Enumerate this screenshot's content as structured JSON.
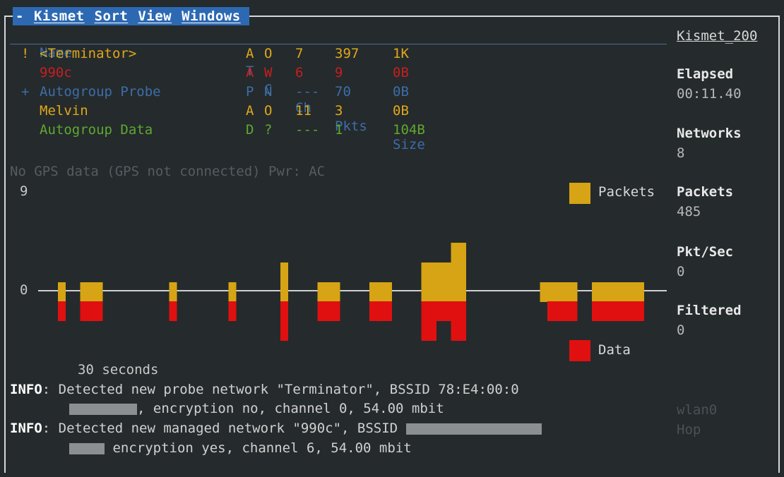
{
  "menubar": {
    "system_icon": "-",
    "items": [
      "Kismet",
      "Sort",
      "View",
      "Windows"
    ]
  },
  "title_right": "Kismet_200",
  "table": {
    "headers": {
      "name": "Name",
      "t": "T",
      "c": "C",
      "ch": "Ch",
      "pkts": "Pkts",
      "size": "Size"
    },
    "rows": [
      {
        "flag": "!",
        "name": "<Terminator>",
        "t": "A",
        "c": "O",
        "ch": "7",
        "pkts": "397",
        "size": "1K",
        "color": "#e0a81a"
      },
      {
        "flag": "",
        "name": "990c",
        "t": "A",
        "c": "W",
        "ch": "6",
        "pkts": "9",
        "size": "0B",
        "color": "#c81e1e"
      },
      {
        "flag": "+",
        "name": "Autogroup Probe",
        "t": "P",
        "c": "N",
        "ch": "---",
        "pkts": "70",
        "size": "0B",
        "color": "#3c6ea8"
      },
      {
        "flag": "",
        "name": "Melvin",
        "t": "A",
        "c": "O",
        "ch": "11",
        "pkts": "3",
        "size": "0B",
        "color": "#e0a81a"
      },
      {
        "flag": "",
        "name": "Autogroup Data",
        "t": "D",
        "c": "?",
        "ch": "---",
        "pkts": "1",
        "size": "104B",
        "color": "#5fa832"
      }
    ]
  },
  "status_msg": "No GPS data (GPS not connected) Pwr: AC",
  "sidebar": {
    "elapsed_label": "Elapsed",
    "elapsed_value": "00:11.40",
    "networks_label": "Networks",
    "networks_value": "8",
    "packets_label": "Packets",
    "packets_value": "485",
    "pktsec_label": "Pkt/Sec",
    "pktsec_value": "0",
    "filtered_label": "Filtered",
    "filtered_value": "0",
    "iface_name": "wlan0",
    "iface_mode": "Hop"
  },
  "chart_data": {
    "type": "bar",
    "y_top_label": "9",
    "y_zero_label": "0",
    "x_label": "30 seconds",
    "legend_packets": "Packets",
    "legend_data": "Data",
    "packets_color": "#d6a414",
    "data_color": "#e01010",
    "packets": [
      1,
      0,
      0,
      1,
      1,
      1,
      0,
      0,
      0,
      0,
      0,
      0,
      0,
      0,
      0,
      1,
      0,
      0,
      0,
      0,
      0,
      0,
      0,
      1,
      0,
      0,
      0,
      0,
      0,
      0,
      2,
      0,
      0,
      0,
      0,
      1,
      1,
      1,
      0,
      0,
      0,
      0,
      1,
      1,
      1,
      0,
      0,
      0,
      0,
      2,
      2,
      2,
      2,
      3,
      3,
      0,
      0,
      0,
      0,
      0,
      0,
      0,
      0,
      0,
      0,
      1,
      1,
      1,
      1,
      1,
      0,
      0,
      1,
      1,
      1,
      1,
      1,
      1,
      1,
      0
    ],
    "data": [
      1,
      0,
      0,
      1,
      1,
      1,
      0,
      0,
      0,
      0,
      0,
      0,
      0,
      0,
      0,
      1,
      0,
      0,
      0,
      0,
      0,
      0,
      0,
      1,
      0,
      0,
      0,
      0,
      0,
      0,
      2,
      0,
      0,
      0,
      0,
      1,
      1,
      1,
      0,
      0,
      0,
      0,
      1,
      1,
      1,
      0,
      0,
      0,
      0,
      2,
      2,
      1,
      1,
      2,
      2,
      0,
      0,
      0,
      0,
      0,
      0,
      0,
      0,
      0,
      0,
      0,
      1,
      1,
      1,
      1,
      0,
      0,
      1,
      1,
      1,
      1,
      1,
      1,
      1,
      0
    ],
    "ylim": [
      0,
      9
    ]
  },
  "log": [
    {
      "tag": "INFO",
      "text": ": Detected new probe network \"Terminator\", BSSID 78:E4:00:0"
    },
    {
      "tag": "",
      "text": ", encryption no, channel 0, 54.00 mbit"
    },
    {
      "tag": "INFO",
      "text": ": Detected new managed network \"990c\", BSSID "
    },
    {
      "tag": "",
      "text": " encryption yes, channel 6, 54.00 mbit"
    }
  ]
}
